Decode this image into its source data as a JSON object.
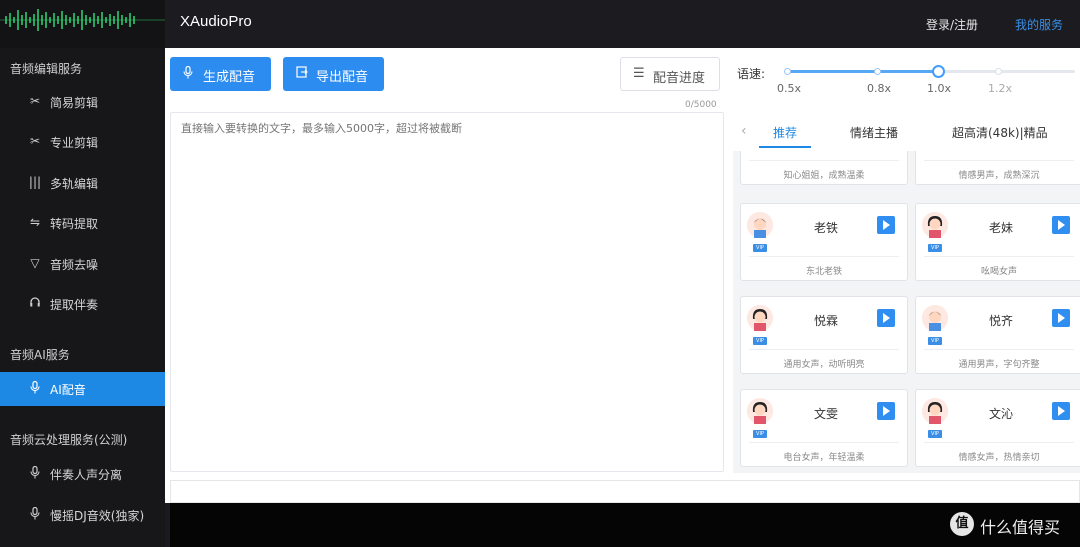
{
  "app": {
    "title": "XAudioPro"
  },
  "header": {
    "login_label": "登录/注册",
    "my_service_label": "我的服务"
  },
  "colors": {
    "accent": "#1e88e5",
    "logo_wave": "#22c55e",
    "sidebar_bg": "#17171a"
  },
  "sidebar": {
    "groups": [
      {
        "title": "音频编辑服务",
        "items": [
          {
            "icon": "scissors-icon",
            "label": "简易剪辑"
          },
          {
            "icon": "scissors-icon",
            "label": "专业剪辑"
          },
          {
            "icon": "tracks-icon",
            "label": "多轨编辑"
          },
          {
            "icon": "convert-icon",
            "label": "转码提取"
          },
          {
            "icon": "funnel-icon",
            "label": "音频去噪"
          },
          {
            "icon": "headphones-icon",
            "label": "提取伴奏"
          }
        ]
      },
      {
        "title": "音频AI服务",
        "items": [
          {
            "icon": "mic-icon",
            "label": "AI配音",
            "active": true
          }
        ]
      },
      {
        "title": "音频云处理服务(公测)",
        "items": [
          {
            "icon": "mic-icon",
            "label": "伴奏人声分离"
          },
          {
            "icon": "mic-icon",
            "label": "慢摇DJ音效(独家)"
          }
        ]
      }
    ]
  },
  "toolbar": {
    "generate_label": "生成配音",
    "export_label": "导出配音",
    "progress_label": "配音进度"
  },
  "editor": {
    "char_count": "0/5000",
    "placeholder": "直接输入要转换的文字，最多输入5000字，超过将被截断"
  },
  "speed": {
    "label": "语速:",
    "marks": [
      "0.5x",
      "0.8x",
      "1.0x",
      "1.2x"
    ],
    "selected": "1.0x"
  },
  "voice_tabs": {
    "items": [
      "推荐",
      "情绪主播",
      "超高清(48k)|精品"
    ],
    "active_index": 0
  },
  "voices": {
    "partial_top": [
      {
        "desc": "知心姐姐，成熟温柔"
      },
      {
        "desc": "情感男声，成熟深沉"
      }
    ],
    "cards": [
      {
        "name": "老铁",
        "desc": "东北老铁",
        "badge": "VIP"
      },
      {
        "name": "老妹",
        "desc": "吆喝女声",
        "badge": "VIP"
      },
      {
        "name": "悦霖",
        "desc": "通用女声，动听明亮",
        "badge": "VIP"
      },
      {
        "name": "悦齐",
        "desc": "通用男声，字句齐整",
        "badge": "VIP"
      },
      {
        "name": "文雯",
        "desc": "电台女声，年轻温柔",
        "badge": "VIP"
      },
      {
        "name": "文沁",
        "desc": "情感女声，热情亲切",
        "badge": "VIP"
      }
    ]
  },
  "watermark": {
    "logo_char": "值",
    "text": "什么值得买"
  }
}
